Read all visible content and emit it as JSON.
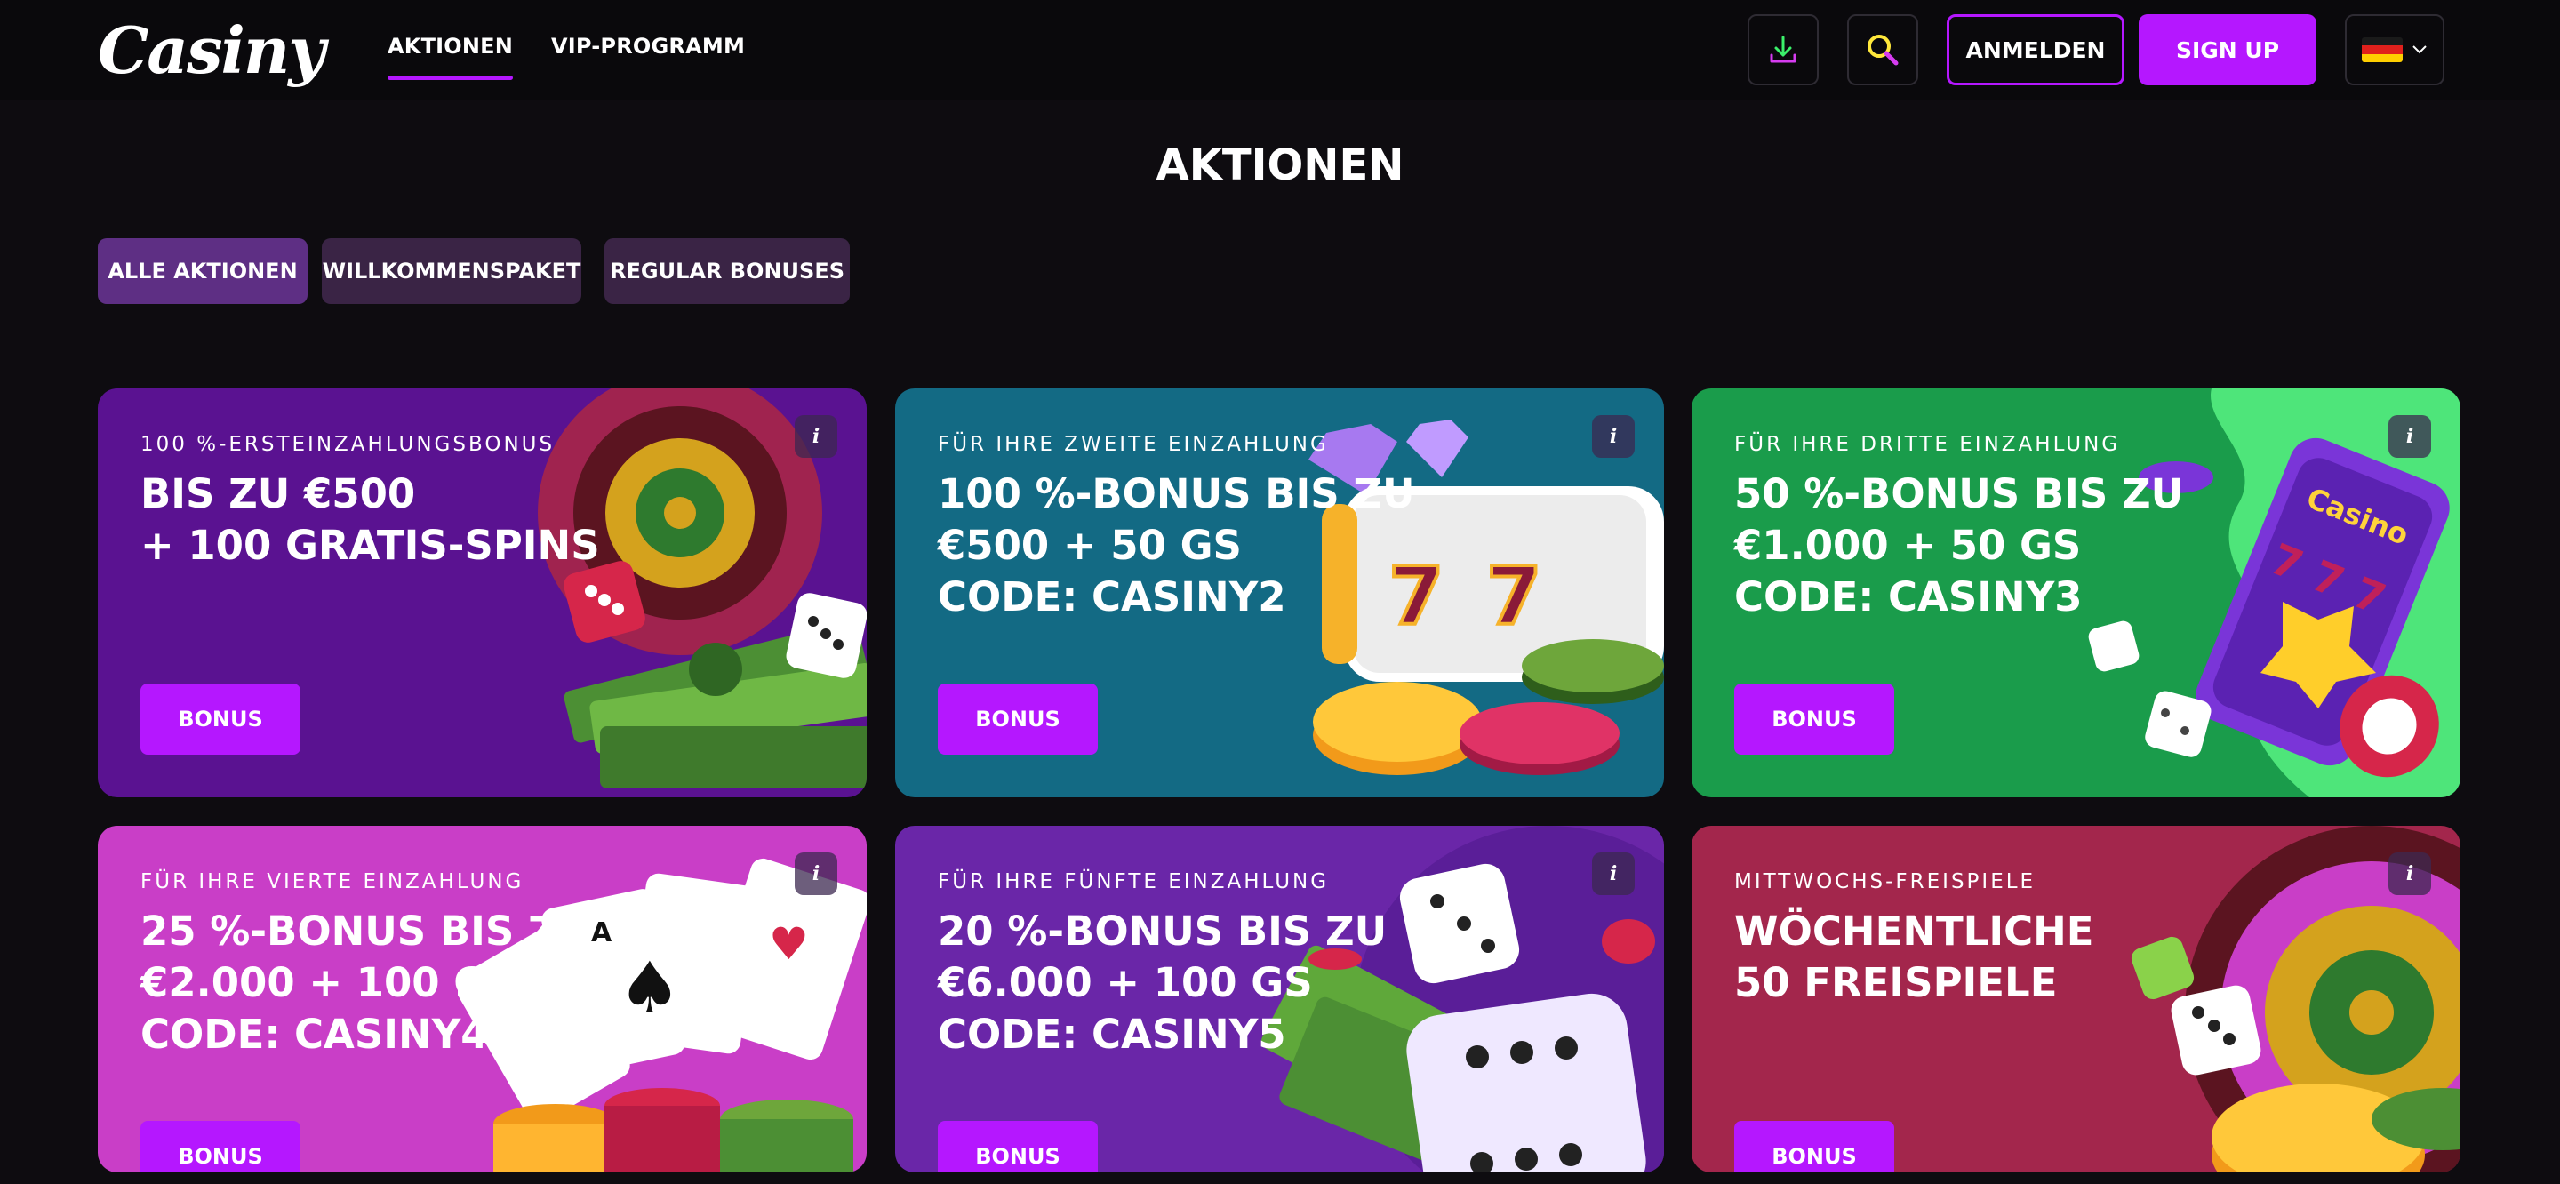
{
  "header": {
    "logo": "Casiny",
    "nav": [
      "AKTIONEN",
      "VIP-PROGRAMM"
    ],
    "download_icon": "download-icon",
    "search_icon": "search-icon",
    "login_label": "ANMELDEN",
    "signup_label": "SIGN UP",
    "language": "de",
    "colors": {
      "accent": "#b517ff",
      "bg": "#0e0c10"
    }
  },
  "page": {
    "title": "AKTIONEN",
    "filters": [
      "ALLE AKTIONEN",
      "WILLKOMMENSPAKET",
      "REGULAR BONUSES"
    ]
  },
  "cards": [
    {
      "kicker": "100 %-ERSTEINZAHLUNGSBONUS",
      "headline": "BIS ZU €500\n+ 100 GRATIS-SPINS",
      "button": "BONUS",
      "info": "i",
      "bg": "#5a1291",
      "art": "roulette-money-dice"
    },
    {
      "kicker": "FÜR IHRE ZWEITE EINZAHLUNG",
      "headline": "100 %-BONUS BIS ZU\n€500 + 50 GS\nCODE: CASINY2",
      "button": "BONUS",
      "info": "i",
      "bg": "#136a84",
      "art": "slot-diamonds-chips"
    },
    {
      "kicker": "FÜR IHRE DRITTE EINZAHLUNG",
      "headline": "50 %-BONUS BIS ZU\n€1.000 + 50 GS\nCODE: CASINY3",
      "button": "BONUS",
      "info": "i",
      "bg": "#1a9c4b",
      "art": "phone-slot-jackpot"
    },
    {
      "kicker": "FÜR IHRE VIERTE EINZAHLUNG",
      "headline": "25 %-BONUS BIS ZU\n€2.000 + 100 GS\nCODE: CASINY4",
      "button": "BONUS",
      "info": "i",
      "bg": "#c93ec7",
      "art": "cards-chips"
    },
    {
      "kicker": "FÜR IHRE FÜNFTE EINZAHLUNG",
      "headline": "20 %-BONUS BIS ZU\n€6.000 + 100 GS\nCODE: CASINY5",
      "button": "BONUS",
      "info": "i",
      "bg": "#6a26a8",
      "art": "dice-money"
    },
    {
      "kicker": "MITTWOCHS-FREISPIELE",
      "headline": "WÖCHENTLICHE\n50 FREISPIELE",
      "button": "BONUS",
      "info": "i",
      "bg": "#a3264c",
      "art": "roulette-dice-chips"
    }
  ]
}
